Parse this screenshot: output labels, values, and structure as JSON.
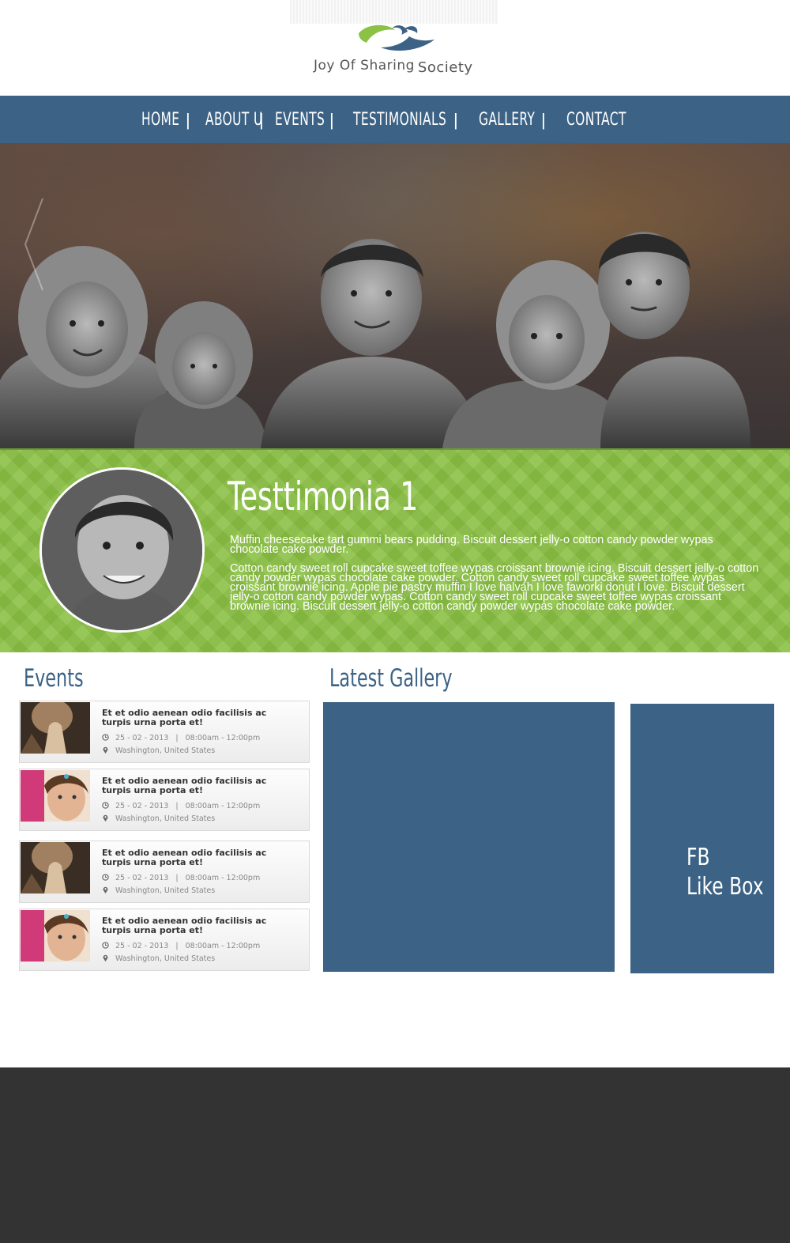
{
  "brand": {
    "name": "Joy Of Sharing",
    "suffix": "Society"
  },
  "nav": {
    "items": [
      {
        "label": "HOME"
      },
      {
        "label": "ABOUT U"
      },
      {
        "label": "EVENTS"
      },
      {
        "label": "TESTIMONIALS"
      },
      {
        "label": "GALLERY"
      },
      {
        "label": "CONTACT"
      }
    ],
    "separator": "|"
  },
  "testimonial": {
    "title": "Testtimonia 1",
    "paragraph1": "Muffin cheesecake tart gummi bears pudding. Biscuit dessert jelly-o cotton candy powder wypas chocolate cake powder.",
    "paragraph2": "Cotton candy sweet roll cupcake sweet toffee wypas croissant brownie icing. Biscuit dessert jelly-o cotton candy powder wypas chocolate cake powder. Cotton candy sweet roll cupcake sweet toffee wypas croissant brownie icing. Apple pie pastry muffin I love halvah I love faworki donut I love. Biscuit dessert jelly-o cotton candy powder wypas. Cotton candy sweet roll cupcake sweet toffee wypas croissant brownie icing. Biscuit dessert jelly-o cotton candy powder wypas chocolate cake powder."
  },
  "events": {
    "title": "Events",
    "items": [
      {
        "title": "Et et odio aenean odio facilisis ac turpis urna porta et!",
        "date": "25 - 02 - 2013",
        "time": "08:00am - 12:00pm",
        "location": "Washington, United States",
        "thumb": "praying-hands"
      },
      {
        "title": "Et et odio aenean odio facilisis ac turpis urna porta et!",
        "date": "25 - 02 - 2013",
        "time": "08:00am - 12:00pm",
        "location": "Washington, United States",
        "thumb": "girl-portrait"
      },
      {
        "title": "Et et odio aenean odio facilisis ac turpis urna porta et!",
        "date": "25 - 02 - 2013",
        "time": "08:00am - 12:00pm",
        "location": "Washington, United States",
        "thumb": "praying-hands"
      },
      {
        "title": "Et et odio aenean odio facilisis ac turpis urna porta et!",
        "date": "25 - 02 - 2013",
        "time": "08:00am - 12:00pm",
        "location": "Washington, United States",
        "thumb": "girl-portrait"
      }
    ]
  },
  "gallery": {
    "title": "Latest Gallery"
  },
  "fb": {
    "line1": "FB",
    "line2": "Like Box"
  },
  "colors": {
    "primary": "#3c6285",
    "accent_green": "#8bc145",
    "footer": "#333333"
  }
}
